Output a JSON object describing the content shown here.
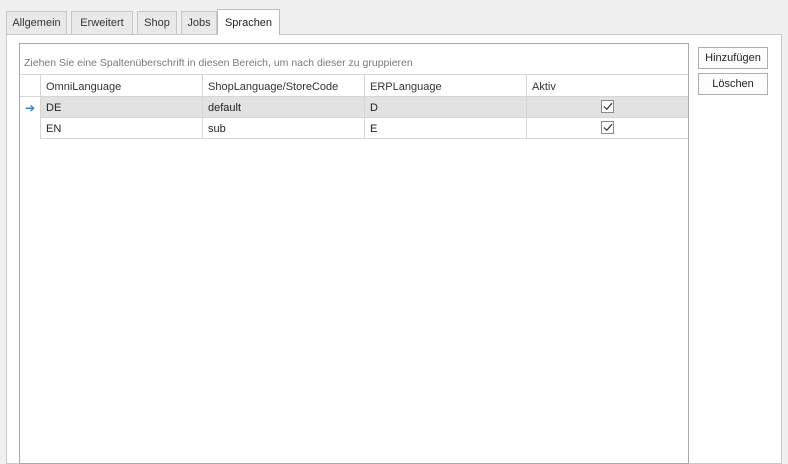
{
  "tabs": [
    "Allgemein",
    "Erweitert",
    "Shop",
    "Jobs",
    "Sprachen"
  ],
  "active_tab": "Sprachen",
  "grid": {
    "group_panel_text": "Ziehen Sie eine Spaltenüberschrift in diesen Bereich, um nach dieser zu gruppieren",
    "columns": [
      "OmniLanguage",
      "ShopLanguage/StoreCode",
      "ERPLanguage",
      "Aktiv"
    ],
    "rows": [
      {
        "omni": "DE",
        "shop": "default",
        "erp": "D",
        "aktiv": true,
        "focused": true
      },
      {
        "omni": "EN",
        "shop": "sub",
        "erp": "E",
        "aktiv": true,
        "focused": false
      }
    ],
    "row_indicator_icon": "arrow-right-icon",
    "check_icon": "checkmark-icon"
  },
  "buttons": {
    "add_label": "Hinzufügen",
    "delete_label": "Löschen"
  },
  "colors": {
    "focused_row": "#e2e2e2",
    "indicator_arrow": "#3a7bd5"
  }
}
